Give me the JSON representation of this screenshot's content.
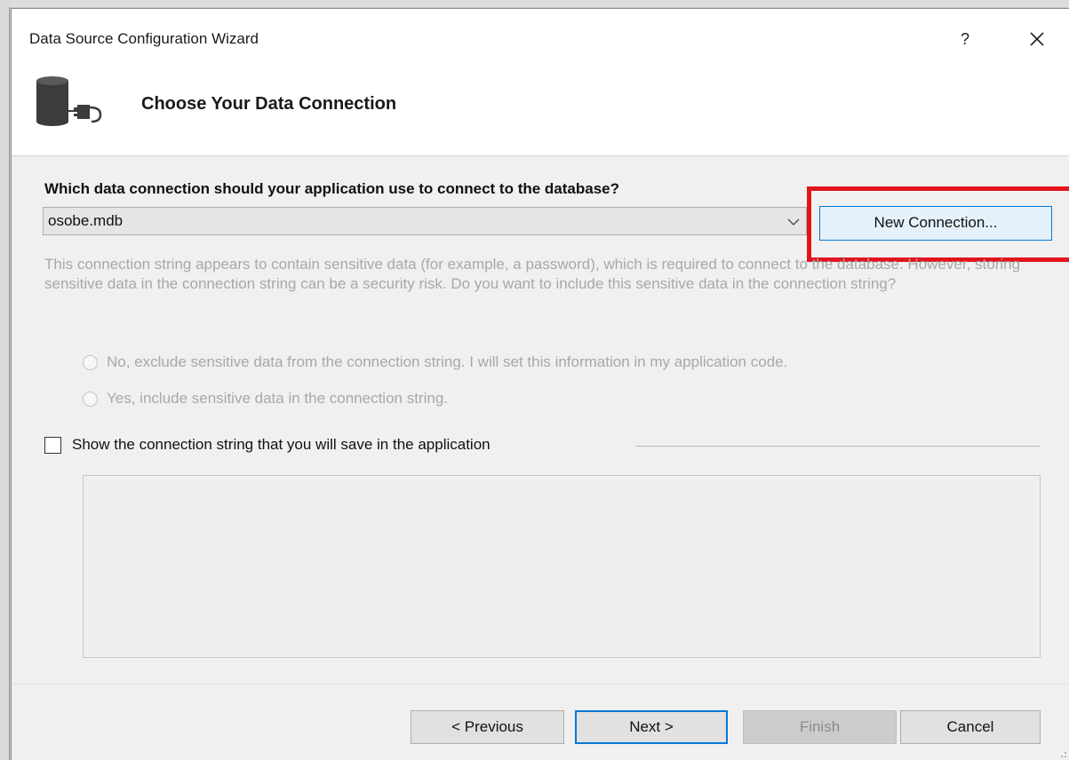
{
  "window": {
    "title": "Data Source Configuration Wizard",
    "help_label": "?",
    "close_label": "✕"
  },
  "page": {
    "title": "Choose Your Data Connection",
    "icon": "database-plug-icon"
  },
  "connection": {
    "question": "Which data connection should your application use to connect to the database?",
    "selected_value": "osobe.mdb",
    "new_connection_label": "New Connection...",
    "highlight_color": "#e3141d"
  },
  "sensitive": {
    "warning": "This connection string appears to contain sensitive data (for example, a password), which is required to connect to the database. However, storing sensitive data in the connection string can be a security risk. Do you want to include this sensitive data in the connection string?",
    "option_no": "No, exclude sensitive data from the connection string. I will set this information in my application code.",
    "option_yes": "Yes, include sensitive data in the connection string."
  },
  "show_string": {
    "label": "Show the connection string that you will save in the application",
    "checked": false
  },
  "buttons": {
    "previous": "< Previous",
    "next": "Next >",
    "finish": "Finish",
    "cancel": "Cancel"
  },
  "colors": {
    "accent": "#0078d7",
    "dialog_bg": "#f0f0f0",
    "disabled_text": "#a8a8a8"
  }
}
